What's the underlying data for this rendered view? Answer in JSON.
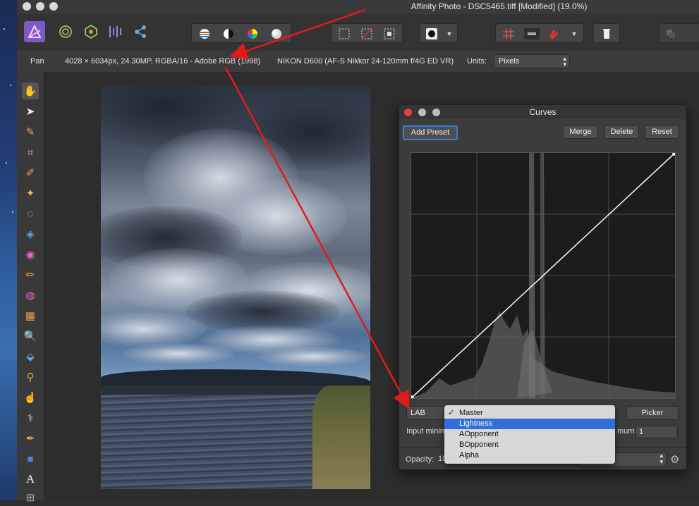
{
  "window": {
    "title": "Affinity Photo - DSC5465.tiff [Modified] (19.0%)"
  },
  "context_bar": {
    "tool_name": "Pan",
    "doc_info": "4028 × 6034px, 24.30MP, RGBA/16 - Adobe RGB (1998)",
    "camera_info": "NIKON D600 (AF-S Nikkor 24-120mm f/4G ED VR)",
    "units_label": "Units:",
    "units_value": "Pixels"
  },
  "curves_panel": {
    "title": "Curves",
    "buttons": {
      "add_preset": "Add Preset",
      "merge": "Merge",
      "delete": "Delete",
      "reset": "Reset",
      "picker": "Picker"
    },
    "colour_space": "LAB",
    "input_min_label": "Input minim",
    "input_max_label_tail": "mum:",
    "input_max_value": "1",
    "opacity_label": "Opacity:",
    "opacity_value": "10"
  },
  "channel_menu": {
    "items": [
      {
        "label": "Master",
        "checked": "✓"
      },
      {
        "label": "Lightness",
        "checked": ""
      },
      {
        "label": "AOpponent",
        "checked": ""
      },
      {
        "label": "BOpponent",
        "checked": ""
      },
      {
        "label": "Alpha",
        "checked": ""
      }
    ],
    "highlighted": "Lightness"
  },
  "icons": {
    "persona_photo": "photo-persona-icon",
    "persona_liquify": "liquify-persona-icon",
    "persona_develop": "develop-persona-icon",
    "persona_tonemap": "tone-mapping-persona-icon",
    "persona_export": "export-persona-icon"
  },
  "colors": {
    "accent_blue": "#2f6fd6",
    "annotation_red": "#e01b1b",
    "curve": "#ffffff"
  }
}
